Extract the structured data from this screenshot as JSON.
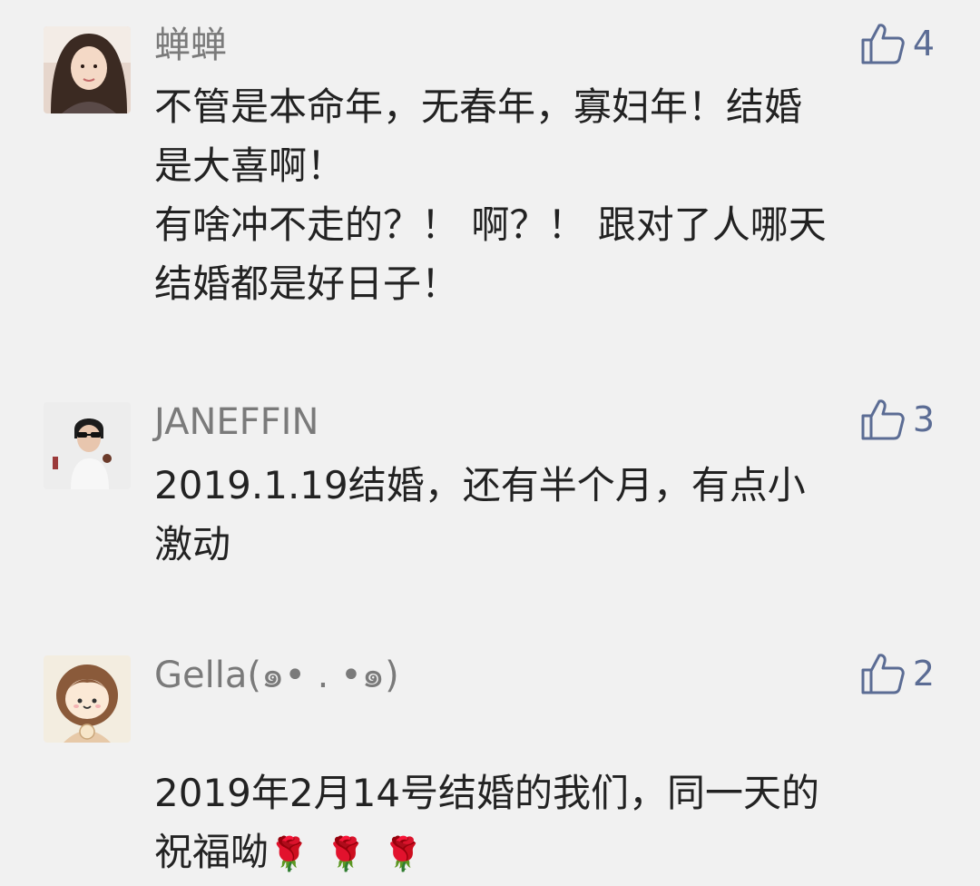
{
  "comments": [
    {
      "name": "蝉蝉",
      "likes": "4",
      "text": "不管是本命年，无春年，寡妇年！结婚\n是大喜啊！\n有啥冲不走的？！ 啊？！ 跟对了人哪天\n结婚都是好日子！",
      "avatar": "woman-photo-avatar"
    },
    {
      "name": "JANEFFIN",
      "likes": "3",
      "text": "2019.1.19结婚，还有半个月，有点小\n激动",
      "avatar": "woman-sunglasses-avatar"
    },
    {
      "name": "Gella(๑• . •๑)",
      "likes": "2",
      "text": "2019年2月14号结婚的我们，同一天的\n祝福呦",
      "emoji": "🌹🌹🌹",
      "avatar": "cartoon-girl-avatar"
    }
  ],
  "icons": {
    "like": "thumbs-up-icon"
  },
  "colors": {
    "background": "#f1f1f1",
    "name": "#7a7a7a",
    "text": "#222222",
    "like": "#5b6c94"
  }
}
